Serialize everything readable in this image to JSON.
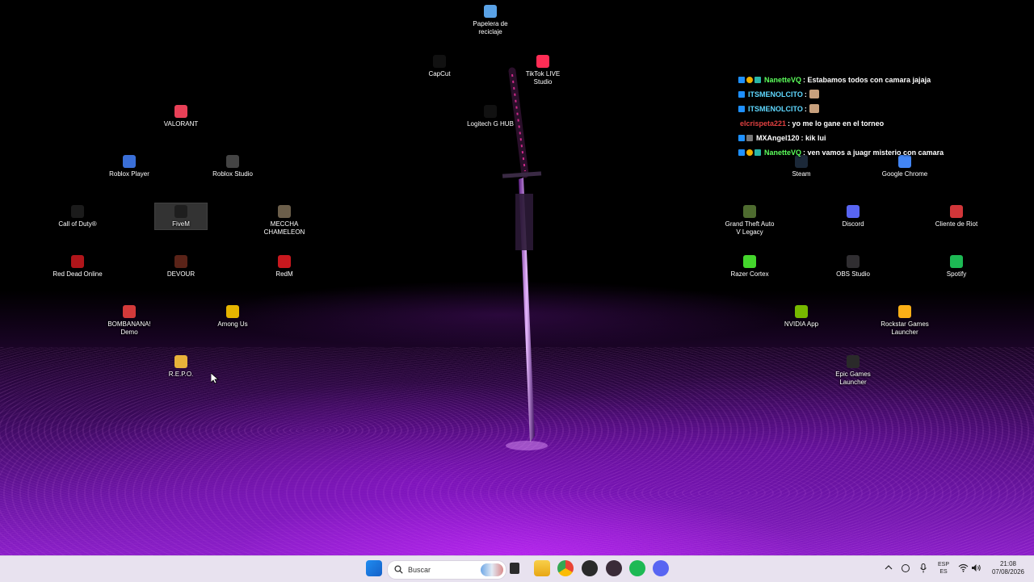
{
  "desktop": {
    "icons": [
      {
        "name": "papelera-de-reciclaje",
        "label": "Papelera de reciclaje",
        "icon": "recycle-bin-icon",
        "color": "#5aa2e6"
      },
      {
        "name": "capcut",
        "label": "CapCut",
        "icon": "capcut-icon",
        "color": "#111111"
      },
      {
        "name": "tiktok-live-studio",
        "label": "TikTok LIVE Studio",
        "icon": "tiktok-icon",
        "color": "#ff2d55"
      },
      {
        "name": "logitech-g-hub",
        "label": "Logitech G HUB",
        "icon": "logitech-icon",
        "color": "#111111"
      },
      {
        "name": "valorant",
        "label": "VALORANT",
        "icon": "valorant-icon",
        "color": "#e84057"
      },
      {
        "name": "roblox-player",
        "label": "Roblox Player",
        "icon": "roblox-icon",
        "color": "#3a6fd8"
      },
      {
        "name": "roblox-studio",
        "label": "Roblox Studio",
        "icon": "roblox-studio-icon",
        "color": "#444444"
      },
      {
        "name": "call-of-duty",
        "label": "Call of Duty®",
        "icon": "call-of-duty-icon",
        "color": "#1b1b1b"
      },
      {
        "name": "fivem",
        "label": "FiveM",
        "icon": "fivem-icon",
        "color": "#1e1e1e"
      },
      {
        "name": "meccha-chameleon",
        "label": "MECCHA CHAMELEON",
        "icon": "chameleon-icon",
        "color": "#6b5e4a"
      },
      {
        "name": "red-dead-online",
        "label": "Red Dead Online",
        "icon": "red-dead-icon",
        "color": "#b0151a"
      },
      {
        "name": "devour",
        "label": "DEVOUR",
        "icon": "devour-icon",
        "color": "#5a2318"
      },
      {
        "name": "redm",
        "label": "RedM",
        "icon": "redm-icon",
        "color": "#c8181e"
      },
      {
        "name": "bombanana-demo",
        "label": "BOMBANANA! Demo",
        "icon": "bombanana-icon",
        "color": "#d33a3a"
      },
      {
        "name": "among-us",
        "label": "Among Us",
        "icon": "among-us-icon",
        "color": "#e6b400"
      },
      {
        "name": "repo",
        "label": "R.E.P.O.",
        "icon": "repo-icon",
        "color": "#e8b23a"
      },
      {
        "name": "steam",
        "label": "Steam",
        "icon": "steam-icon",
        "color": "#1b2838"
      },
      {
        "name": "google-chrome",
        "label": "Google Chrome",
        "icon": "chrome-icon",
        "color": "#4285f4"
      },
      {
        "name": "gta-v-legacy",
        "label": "Grand Theft Auto V Legacy",
        "icon": "gta-icon",
        "color": "#4e6b2f"
      },
      {
        "name": "discord",
        "label": "Discord",
        "icon": "discord-icon",
        "color": "#5865f2"
      },
      {
        "name": "cliente-de-riot",
        "label": "Cliente de Riot",
        "icon": "riot-icon",
        "color": "#d13639"
      },
      {
        "name": "razer-cortex",
        "label": "Razer Cortex",
        "icon": "razer-icon",
        "color": "#44d62c"
      },
      {
        "name": "obs-studio",
        "label": "OBS Studio",
        "icon": "obs-icon",
        "color": "#302e31"
      },
      {
        "name": "spotify",
        "label": "Spotify",
        "icon": "spotify-icon",
        "color": "#1db954"
      },
      {
        "name": "nvidia-app",
        "label": "NVIDIA App",
        "icon": "nvidia-icon",
        "color": "#76b900"
      },
      {
        "name": "rockstar-games-launcher",
        "label": "Rockstar Games Launcher",
        "icon": "rockstar-icon",
        "color": "#fcaf17"
      },
      {
        "name": "epic-games-launcher",
        "label": "Epic Games Launcher",
        "icon": "epic-games-icon",
        "color": "#2a2a2a"
      }
    ]
  },
  "chat": [
    {
      "user": "NanetteVQ",
      "user_color": "#5cff5c",
      "message": ": Estabamos todos con camara jajaja",
      "badges": [
        "blue",
        "gold",
        "teal"
      ]
    },
    {
      "user": "ITSMENOLCITO",
      "user_color": "#5fd8ff",
      "message": ":",
      "badges": [
        "blue"
      ],
      "emote": true
    },
    {
      "user": "ITSMENOLCITO",
      "user_color": "#5fd8ff",
      "message": ":",
      "badges": [
        "blue"
      ],
      "emote": true
    },
    {
      "user": "elcrispeta221",
      "user_color": "#e04040",
      "message": ": yo me lo gane en el torneo",
      "badges": []
    },
    {
      "user": "MXAngel120",
      "user_color": "#ffffff",
      "message": ": kik lui",
      "badges": [
        "blue",
        "gray"
      ]
    },
    {
      "user": "NanetteVQ",
      "user_color": "#5cff5c",
      "message": ": ven vamos a juagr misterio con camara",
      "badges": [
        "blue",
        "gold",
        "teal"
      ]
    }
  ],
  "taskbar": {
    "search_placeholder": "Buscar",
    "apps": [
      "start-icon",
      "task-view-icon",
      "file-explorer-icon",
      "chrome-icon",
      "obs-icon",
      "game-icon",
      "spotify-icon",
      "discord-icon"
    ],
    "language_top": "ESP",
    "language_bottom": "ES",
    "time": "21:08",
    "date": "07/08/2026"
  }
}
